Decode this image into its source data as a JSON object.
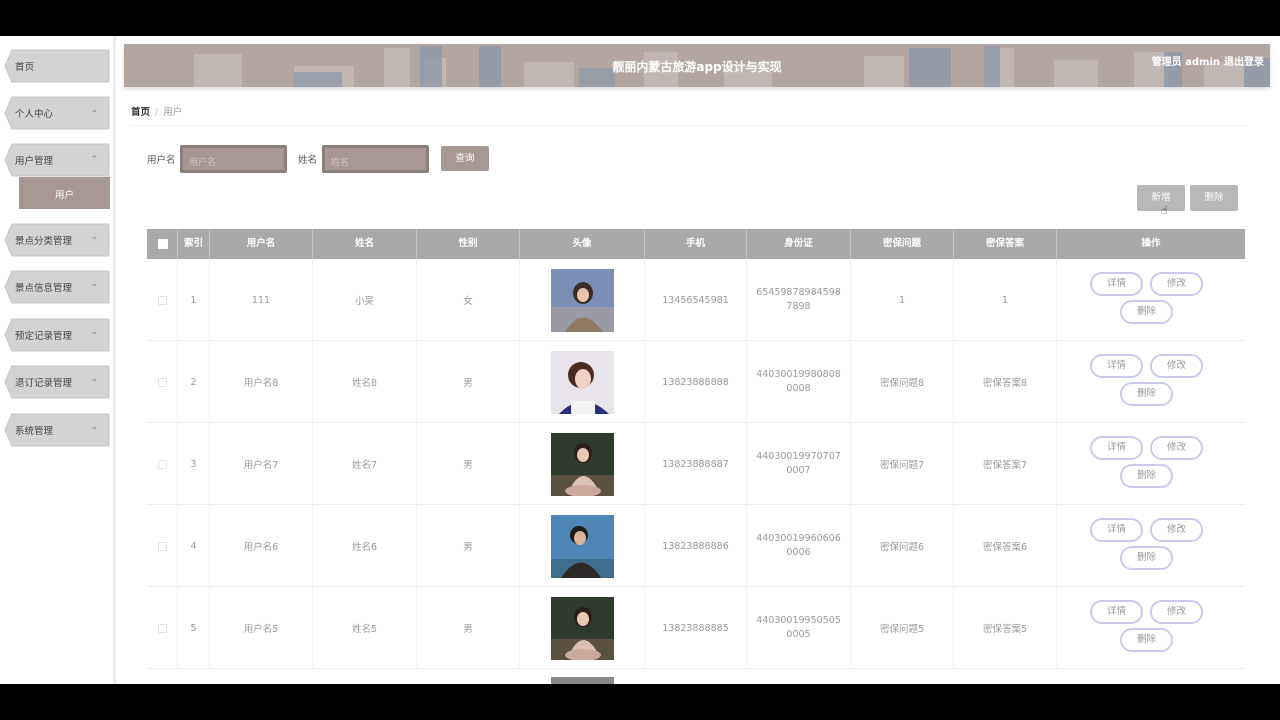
{
  "app": {
    "title": "靓丽内蒙古旅游app设计与实现",
    "user_role": "管理员 admin",
    "logout": "退出登录"
  },
  "sidebar": {
    "items": [
      {
        "label": "首页"
      },
      {
        "label": "个人中心"
      },
      {
        "label": "用户管理"
      },
      {
        "label": "景点分类管理"
      },
      {
        "label": "景点信息管理"
      },
      {
        "label": "预定记录管理"
      },
      {
        "label": "退订记录管理"
      },
      {
        "label": "系统管理"
      }
    ],
    "sub_item": "用户"
  },
  "breadcrumb": {
    "home": "首页",
    "current": "用户"
  },
  "search": {
    "username_label": "用户名",
    "username_placeholder": "用户名",
    "name_label": "姓名",
    "name_placeholder": "姓名",
    "query_button": "查询"
  },
  "toolbar": {
    "add": "新增",
    "delete": "删除"
  },
  "table": {
    "headers": [
      "索引",
      "用户名",
      "姓名",
      "性别",
      "头像",
      "手机",
      "身份证",
      "密保问题",
      "密保答案",
      "操作"
    ],
    "actions": {
      "detail": "详情",
      "edit": "修改",
      "delete": "删除"
    },
    "rows": [
      {
        "index": "1",
        "username": "111",
        "name": "小吴",
        "gender": "女",
        "phone": "13456545981",
        "id_card": "654598789845987898",
        "question": "1",
        "answer": "1"
      },
      {
        "index": "2",
        "username": "用户名8",
        "name": "姓名8",
        "gender": "男",
        "phone": "13823888888",
        "id_card": "440300199808080008",
        "question": "密保问题8",
        "answer": "密保答案8"
      },
      {
        "index": "3",
        "username": "用户名7",
        "name": "姓名7",
        "gender": "男",
        "phone": "13823888887",
        "id_card": "440300199707070007",
        "question": "密保问题7",
        "answer": "密保答案7"
      },
      {
        "index": "4",
        "username": "用户名6",
        "name": "姓名6",
        "gender": "男",
        "phone": "13823888886",
        "id_card": "440300199606060006",
        "question": "密保问题6",
        "answer": "密保答案6"
      },
      {
        "index": "5",
        "username": "用户名5",
        "name": "姓名5",
        "gender": "男",
        "phone": "13823888885",
        "id_card": "440300199505050005",
        "question": "密保问题5",
        "answer": "密保答案5"
      }
    ]
  },
  "colors": {
    "accent": "#a79893",
    "header_bg": "#b3a6a1",
    "table_head": "#a9a9a9",
    "action_border": "#c9cbea"
  }
}
